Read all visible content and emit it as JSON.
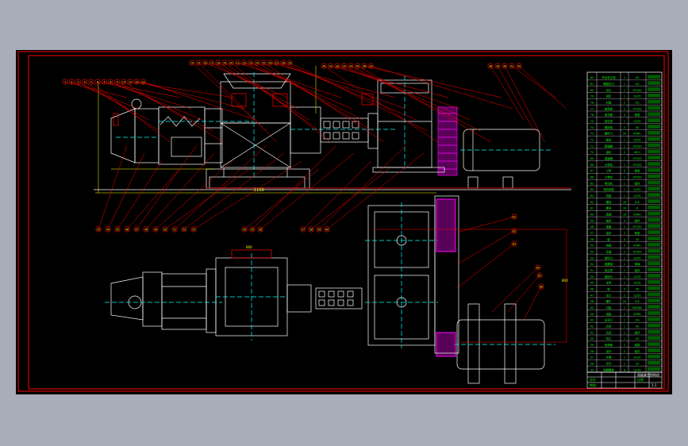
{
  "colors": {
    "viewport_bg": "#a9acb9",
    "paper": "#000000",
    "frame": "#ff0000",
    "outline": "#ffffff",
    "centerline": "#00ffff",
    "leader": "#ff0000",
    "dimension": "#ffff00",
    "belt": "#ff00ff",
    "table_text": "#00ff00"
  },
  "title_block": {
    "drawing_title": "双级真空挤砖机",
    "designer": "设计",
    "checker": "审核",
    "scale_label": "比例",
    "sheet_label": "1:1"
  },
  "dimensions": {
    "top_width": "1150",
    "side_height": "800",
    "box_width": "600"
  },
  "bom_rows": [
    {
      "no": "82",
      "name": "挤出机主轴",
      "qty": "1",
      "mat": "45"
    },
    {
      "no": "81",
      "name": "螺旋绞刀",
      "qty": "1",
      "mat": "ZG"
    },
    {
      "no": "80",
      "name": "机头",
      "qty": "1",
      "mat": "HT200"
    },
    {
      "no": "79",
      "name": "泥缸",
      "qty": "1",
      "mat": "Q235"
    },
    {
      "no": "78",
      "name": "衬套",
      "qty": "2",
      "mat": "ZG"
    },
    {
      "no": "77",
      "name": "轴承座",
      "qty": "2",
      "mat": "HT200"
    },
    {
      "no": "76",
      "name": "密封圈",
      "qty": "4",
      "mat": "橡胶"
    },
    {
      "no": "75",
      "name": "真空室",
      "qty": "1",
      "mat": "Q235"
    },
    {
      "no": "74",
      "name": "搅拌轴",
      "qty": "2",
      "mat": "45"
    },
    {
      "no": "73",
      "name": "搅拌刀",
      "qty": "24",
      "mat": "65Mn"
    },
    {
      "no": "72",
      "name": "箱体",
      "qty": "1",
      "mat": "Q235"
    },
    {
      "no": "71",
      "name": "联轴器",
      "qty": "1",
      "mat": "HT200"
    },
    {
      "no": "70",
      "name": "齿轮",
      "qty": "2",
      "mat": "40Cr"
    },
    {
      "no": "69",
      "name": "减速箱",
      "qty": "1",
      "mat": "HT200"
    },
    {
      "no": "68",
      "name": "大带轮",
      "qty": "1",
      "mat": "HT200"
    },
    {
      "no": "67",
      "name": "V带",
      "qty": "6",
      "mat": "橡胶"
    },
    {
      "no": "66",
      "name": "小带轮",
      "qty": "1",
      "mat": "HT200"
    },
    {
      "no": "65",
      "name": "电动机",
      "qty": "1",
      "mat": "组件"
    },
    {
      "no": "64",
      "name": "电机底座",
      "qty": "1",
      "mat": "Q235"
    },
    {
      "no": "63",
      "name": "机座",
      "qty": "1",
      "mat": "Q235"
    },
    {
      "no": "62",
      "name": "螺栓",
      "qty": "16",
      "mat": "8.8"
    },
    {
      "no": "61",
      "name": "螺母",
      "qty": "16",
      "mat": "8"
    },
    {
      "no": "60",
      "name": "垫圈",
      "qty": "16",
      "mat": "65Mn"
    },
    {
      "no": "59",
      "name": "轴承",
      "qty": "4",
      "mat": "组件"
    },
    {
      "no": "58",
      "name": "端盖",
      "qty": "2",
      "mat": "HT200"
    },
    {
      "no": "57",
      "name": "油封",
      "qty": "2",
      "mat": "橡胶"
    },
    {
      "no": "56",
      "name": "键",
      "qty": "4",
      "mat": "45"
    },
    {
      "no": "55",
      "name": "挡圈",
      "qty": "4",
      "mat": "65Mn"
    },
    {
      "no": "54",
      "name": "压盖",
      "qty": "2",
      "mat": "HT200"
    },
    {
      "no": "53",
      "name": "进料口",
      "qty": "1",
      "mat": "Q235"
    },
    {
      "no": "52",
      "name": "观察窗",
      "qty": "1",
      "mat": "玻璃"
    },
    {
      "no": "51",
      "name": "真空表",
      "qty": "1",
      "mat": "组件"
    },
    {
      "no": "50",
      "name": "管接头",
      "qty": "2",
      "mat": "Q235"
    },
    {
      "no": "49",
      "name": "支架",
      "qty": "2",
      "mat": "Q235"
    },
    {
      "no": "48",
      "name": "销",
      "qty": "4",
      "mat": "45"
    },
    {
      "no": "47",
      "name": "法兰",
      "qty": "2",
      "mat": "Q235"
    },
    {
      "no": "46",
      "name": "螺钉",
      "qty": "24",
      "mat": "8.8"
    },
    {
      "no": "45",
      "name": "衬板",
      "qty": "2",
      "mat": "NM360"
    },
    {
      "no": "44",
      "name": "刮板",
      "qty": "2",
      "mat": "65Mn"
    },
    {
      "no": "43",
      "name": "出泥口",
      "qty": "1",
      "mat": "ZG"
    },
    {
      "no": "42",
      "name": "芯架",
      "qty": "1",
      "mat": "45"
    },
    {
      "no": "41",
      "name": "芯具",
      "qty": "1",
      "mat": "组件"
    },
    {
      "no": "40",
      "name": "机口",
      "qty": "1",
      "mat": "ZG"
    },
    {
      "no": "39",
      "name": "润滑管",
      "qty": "1",
      "mat": "紫铜"
    },
    {
      "no": "38",
      "name": "油杯",
      "qty": "2",
      "mat": "组件"
    },
    {
      "no": "37",
      "name": "护罩",
      "qty": "1",
      "mat": "Q235"
    },
    {
      "no": "36",
      "name": "吊环",
      "qty": "2",
      "mat": "20"
    },
    {
      "no": "35",
      "name": "地脚螺栓",
      "qty": "8",
      "mat": "Q235"
    }
  ],
  "callouts": {
    "top_row": [
      "1",
      "2",
      "3",
      "4",
      "5",
      "6",
      "7",
      "8",
      "9",
      "10",
      "11",
      "12",
      "13",
      "14",
      "15",
      "16",
      "17",
      "18",
      "19",
      "20",
      "21",
      "22",
      "23",
      "24",
      "25",
      "26",
      "27",
      "28",
      "29",
      "30",
      "31",
      "32",
      "33",
      "34",
      "35",
      "36",
      "37",
      "38",
      "39",
      "40",
      "41",
      "42"
    ],
    "bottom_row": [
      "43",
      "44",
      "45",
      "46",
      "47",
      "48",
      "49",
      "50",
      "51",
      "52",
      "53",
      "54",
      "55",
      "56",
      "57",
      "58",
      "59",
      "60"
    ],
    "right_side": [
      "61",
      "62",
      "63",
      "64",
      "65",
      "66"
    ]
  }
}
